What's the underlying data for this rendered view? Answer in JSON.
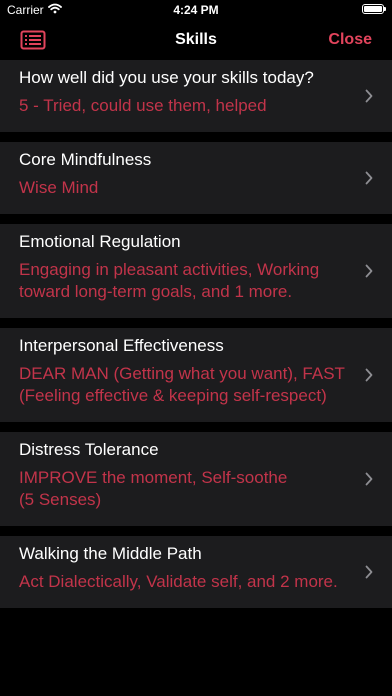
{
  "status_bar": {
    "carrier": "Carrier",
    "time": "4:24 PM",
    "battery_level": 1.0,
    "wifi_icon": "wifi-icon",
    "battery_icon": "battery-icon"
  },
  "nav": {
    "title": "Skills",
    "close_label": "Close",
    "menu_icon": "list-icon",
    "accent_color": "#e2445c"
  },
  "rows": [
    {
      "title": "How well did you use your skills today?",
      "value": "5 - Tried, could use them, helped"
    },
    {
      "title": "Core Mindfulness",
      "value": "Wise Mind"
    },
    {
      "title": "Emotional Regulation",
      "value": "Engaging in pleasant activities, Working\ntoward long-term goals, and 1 more."
    },
    {
      "title": "Interpersonal Effectiveness",
      "value": "DEAR MAN (Getting what you want), FAST\n(Feeling effective & keeping self-respect)"
    },
    {
      "title": "Distress Tolerance",
      "value": "IMPROVE the moment, Self-soothe\n(5 Senses)"
    },
    {
      "title": "Walking the Middle Path",
      "value": "Act Dialectically, Validate self, and 2 more."
    }
  ],
  "colors": {
    "background": "#000000",
    "row_background": "#1c1c1e",
    "value_text": "#c2344a"
  }
}
